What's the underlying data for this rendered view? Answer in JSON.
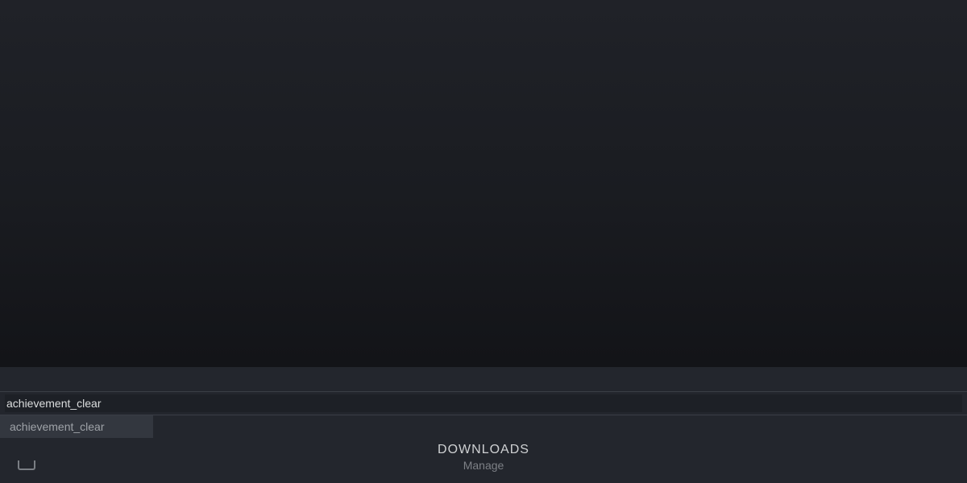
{
  "console": {
    "input_value": "achievement_clear ",
    "suggestions": [
      "achievement_clear"
    ]
  },
  "footer": {
    "downloads_title": "DOWNLOADS",
    "downloads_sub": "Manage"
  }
}
